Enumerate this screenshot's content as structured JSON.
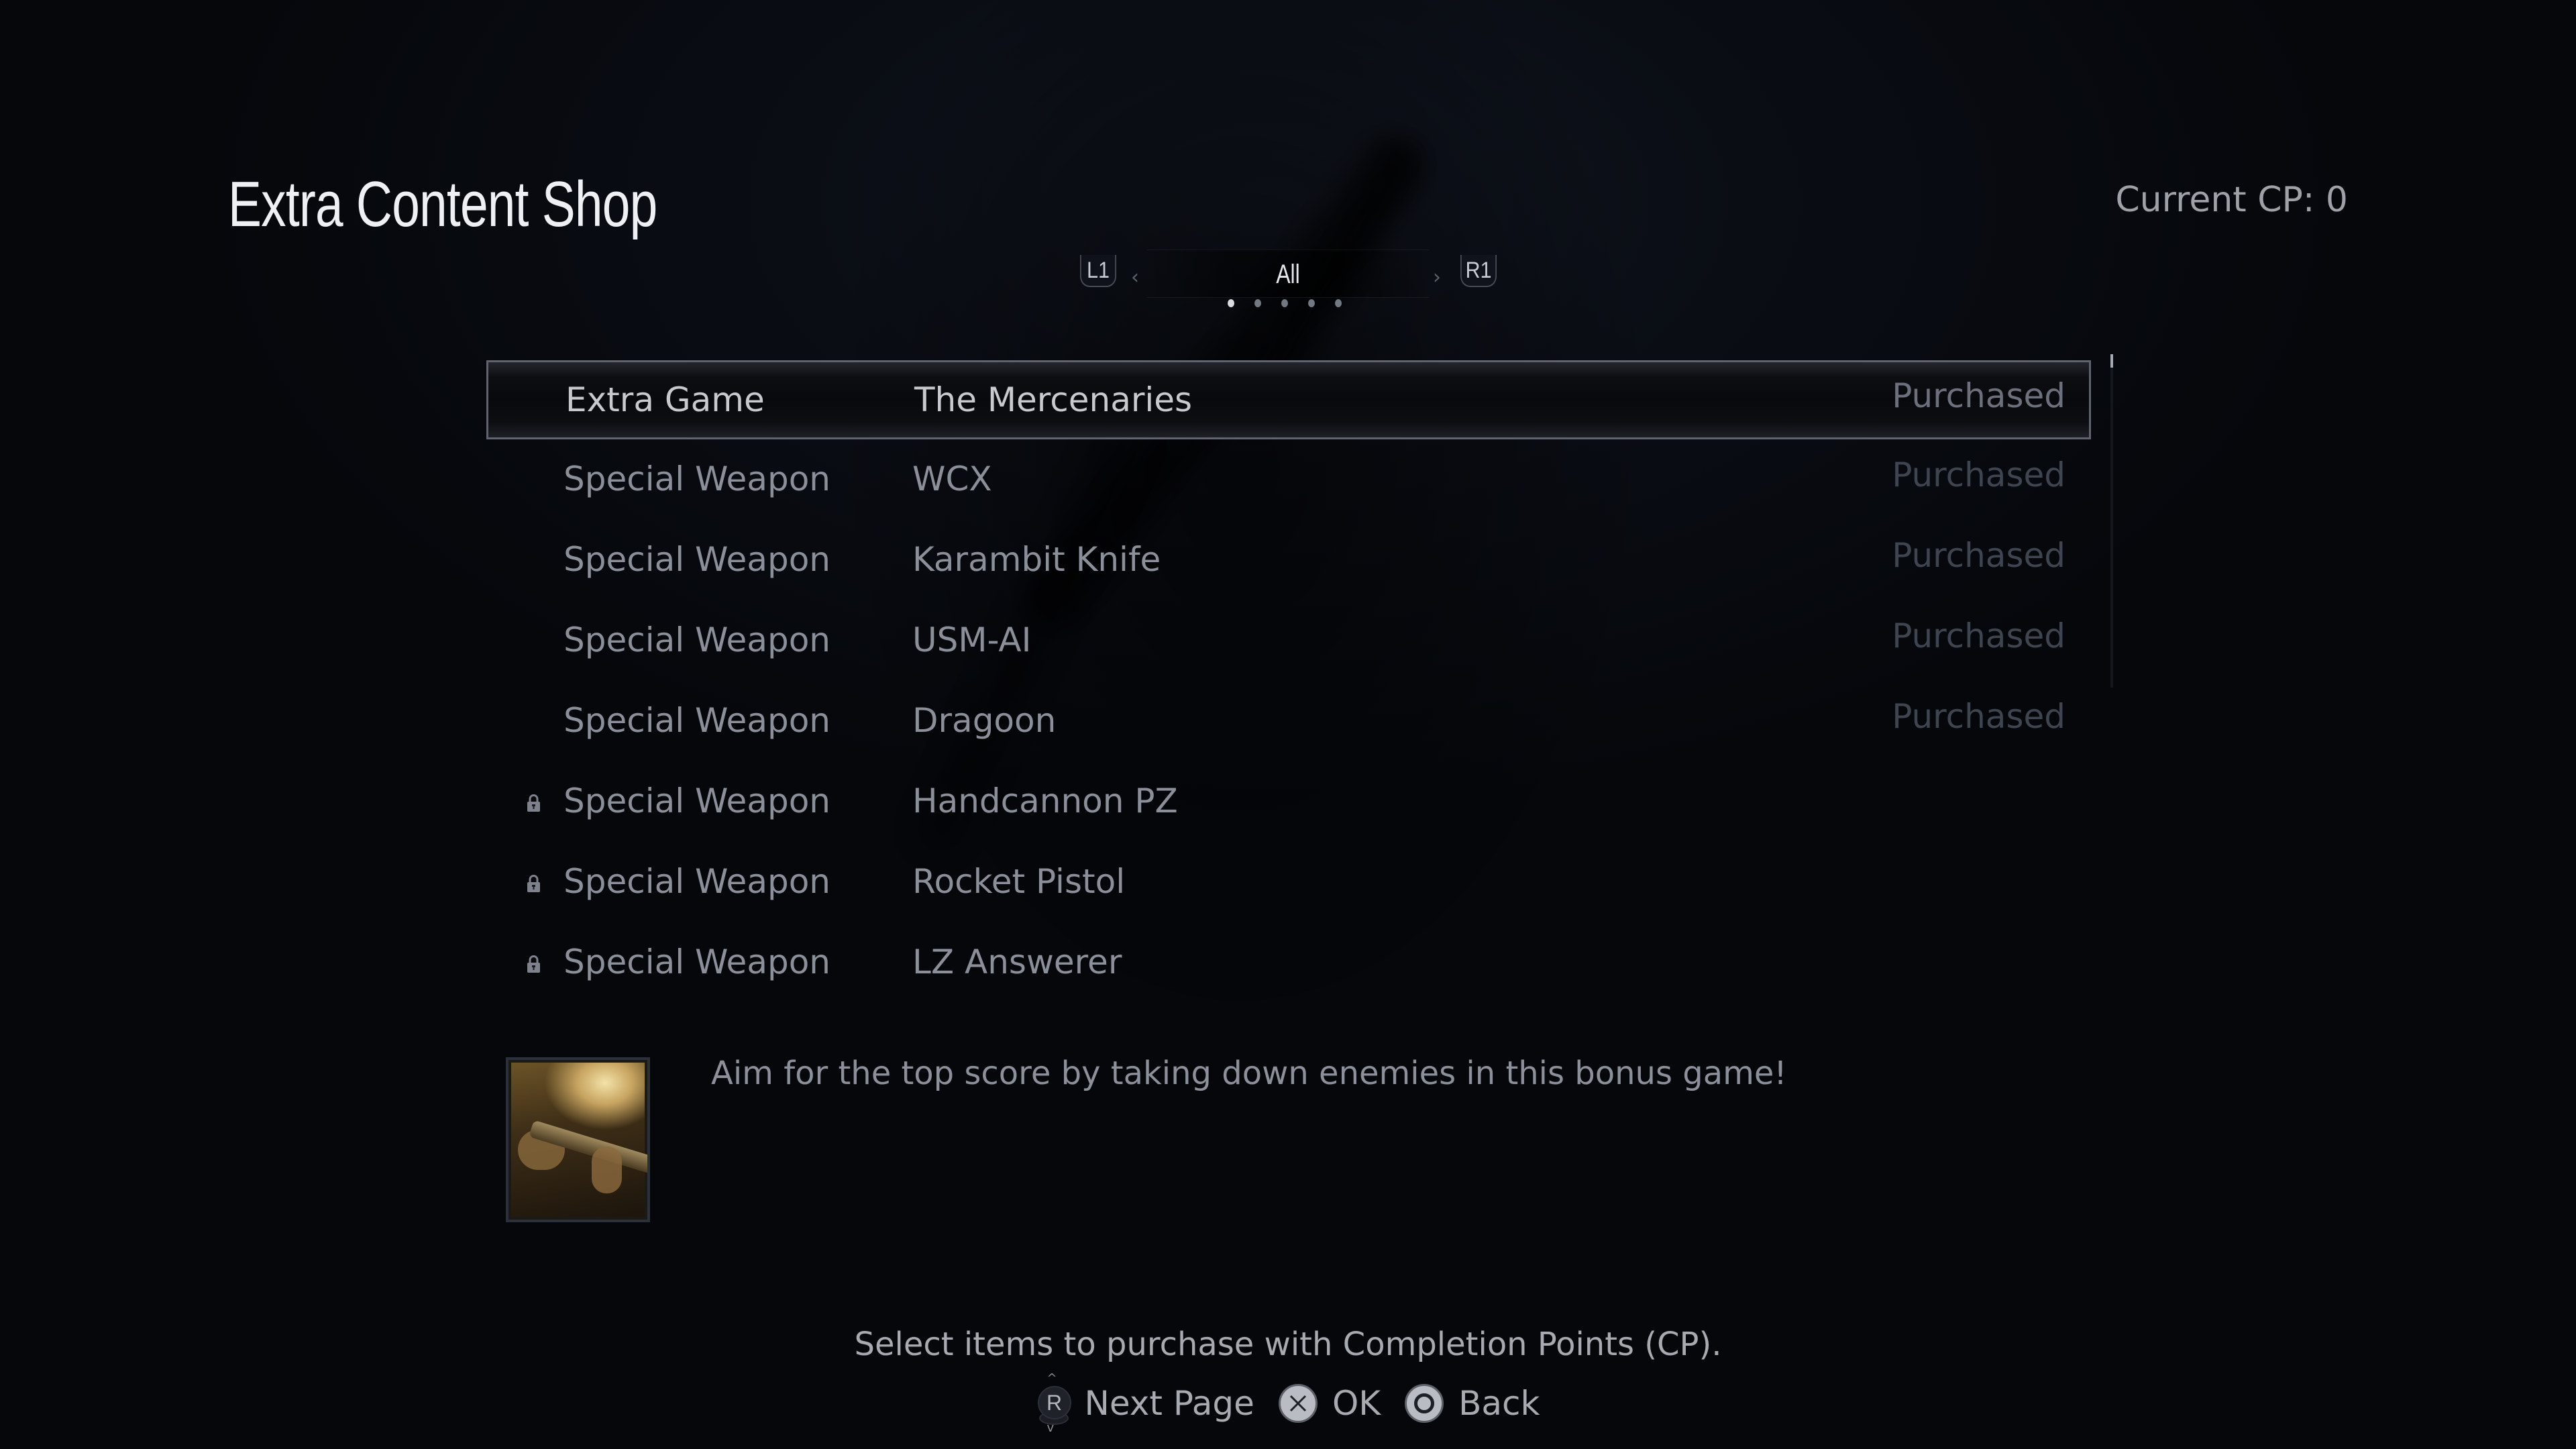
{
  "header": {
    "title": "Extra Content Shop",
    "current_cp": "Current CP: 0"
  },
  "tabs": {
    "left_shoulder": "L1",
    "right_shoulder": "R1",
    "left_arrow": "‹",
    "right_arrow": "›",
    "current": "All",
    "page_count": 5,
    "active_page": 1
  },
  "items": [
    {
      "category": "Extra Game",
      "name": "The Mercenaries",
      "status": "Purchased",
      "locked": false,
      "selected": true
    },
    {
      "category": "Special Weapon",
      "name": "WCX",
      "status": "Purchased",
      "locked": false,
      "selected": false
    },
    {
      "category": "Special Weapon",
      "name": "Karambit Knife",
      "status": "Purchased",
      "locked": false,
      "selected": false
    },
    {
      "category": "Special Weapon",
      "name": "USM-AI",
      "status": "Purchased",
      "locked": false,
      "selected": false
    },
    {
      "category": "Special Weapon",
      "name": "Dragoon",
      "status": "Purchased",
      "locked": false,
      "selected": false
    },
    {
      "category": "Special Weapon",
      "name": "Handcannon PZ",
      "status": "",
      "locked": true,
      "selected": false
    },
    {
      "category": "Special Weapon",
      "name": "Rocket Pistol",
      "status": "",
      "locked": true,
      "selected": false
    },
    {
      "category": "Special Weapon",
      "name": "LZ Answerer",
      "status": "",
      "locked": true,
      "selected": false
    }
  ],
  "detail": {
    "thumbnail_icon": "mercenaries-thumbnail",
    "description": "Aim for the top score by taking down enemies in this bonus game!"
  },
  "footer": {
    "hint": "Select items to purchase with Completion Points (CP).",
    "controls": [
      {
        "icon": "right-stick-icon",
        "glyph": "R",
        "label": "Next Page"
      },
      {
        "icon": "cross-button-icon",
        "glyph": "✕",
        "label": "OK"
      },
      {
        "icon": "circle-button-icon",
        "glyph": "○",
        "label": "Back"
      }
    ]
  },
  "icons": {
    "lock": "lock-icon"
  },
  "colors": {
    "title": "#eef0f4",
    "selected_text": "#c7c9ce",
    "row_text": "#8a8f99",
    "status_dim": "#3e4550",
    "status_selected": "#6b707c",
    "selection_border": "#5f6470",
    "background": "#05070b"
  }
}
